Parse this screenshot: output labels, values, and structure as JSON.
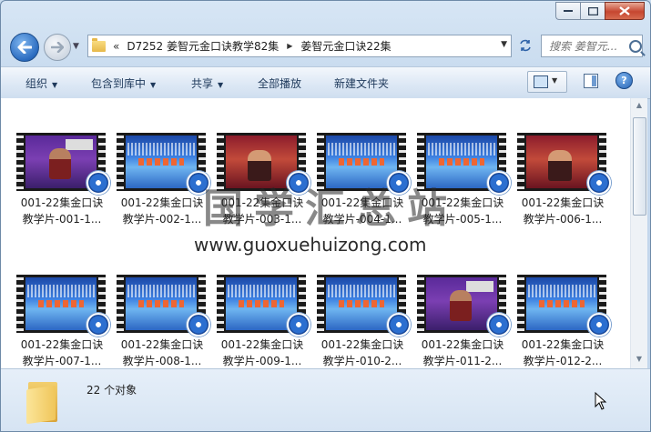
{
  "address": {
    "overflow": "«",
    "crumbs": [
      "D7252 姜智元金口诀教学82集",
      "姜智元金口诀22集"
    ]
  },
  "search": {
    "placeholder": "搜索 姜智元..."
  },
  "toolbar": {
    "organize": "组织",
    "include": "包含到库中",
    "share": "共享",
    "play_all": "全部播放",
    "new_folder": "新建文件夹"
  },
  "files": [
    {
      "line1": "001-22集金口诀",
      "line2": "教学片-001-1...",
      "thumb": "purple"
    },
    {
      "line1": "001-22集金口诀",
      "line2": "教学片-002-1...",
      "thumb": "blue"
    },
    {
      "line1": "001-22集金口诀",
      "line2": "教学片-003-1...",
      "thumb": "red"
    },
    {
      "line1": "001-22集金口诀",
      "line2": "教学片-004-1...",
      "thumb": "blue"
    },
    {
      "line1": "001-22集金口诀",
      "line2": "教学片-005-1...",
      "thumb": "blue"
    },
    {
      "line1": "001-22集金口诀",
      "line2": "教学片-006-1...",
      "thumb": "red"
    },
    {
      "line1": "001-22集金口诀",
      "line2": "教学片-007-1...",
      "thumb": "blue"
    },
    {
      "line1": "001-22集金口诀",
      "line2": "教学片-008-1...",
      "thumb": "blue"
    },
    {
      "line1": "001-22集金口诀",
      "line2": "教学片-009-1...",
      "thumb": "blue"
    },
    {
      "line1": "001-22集金口诀",
      "line2": "教学片-010-2...",
      "thumb": "blue"
    },
    {
      "line1": "001-22集金口诀",
      "line2": "教学片-011-2...",
      "thumb": "purple"
    },
    {
      "line1": "001-22集金口诀",
      "line2": "教学片-012-2...",
      "thumb": "blue"
    }
  ],
  "watermark": {
    "cn": "国学汇总站",
    "url": "www.guoxuehuizong.com"
  },
  "details": {
    "count": "22 个对象"
  }
}
